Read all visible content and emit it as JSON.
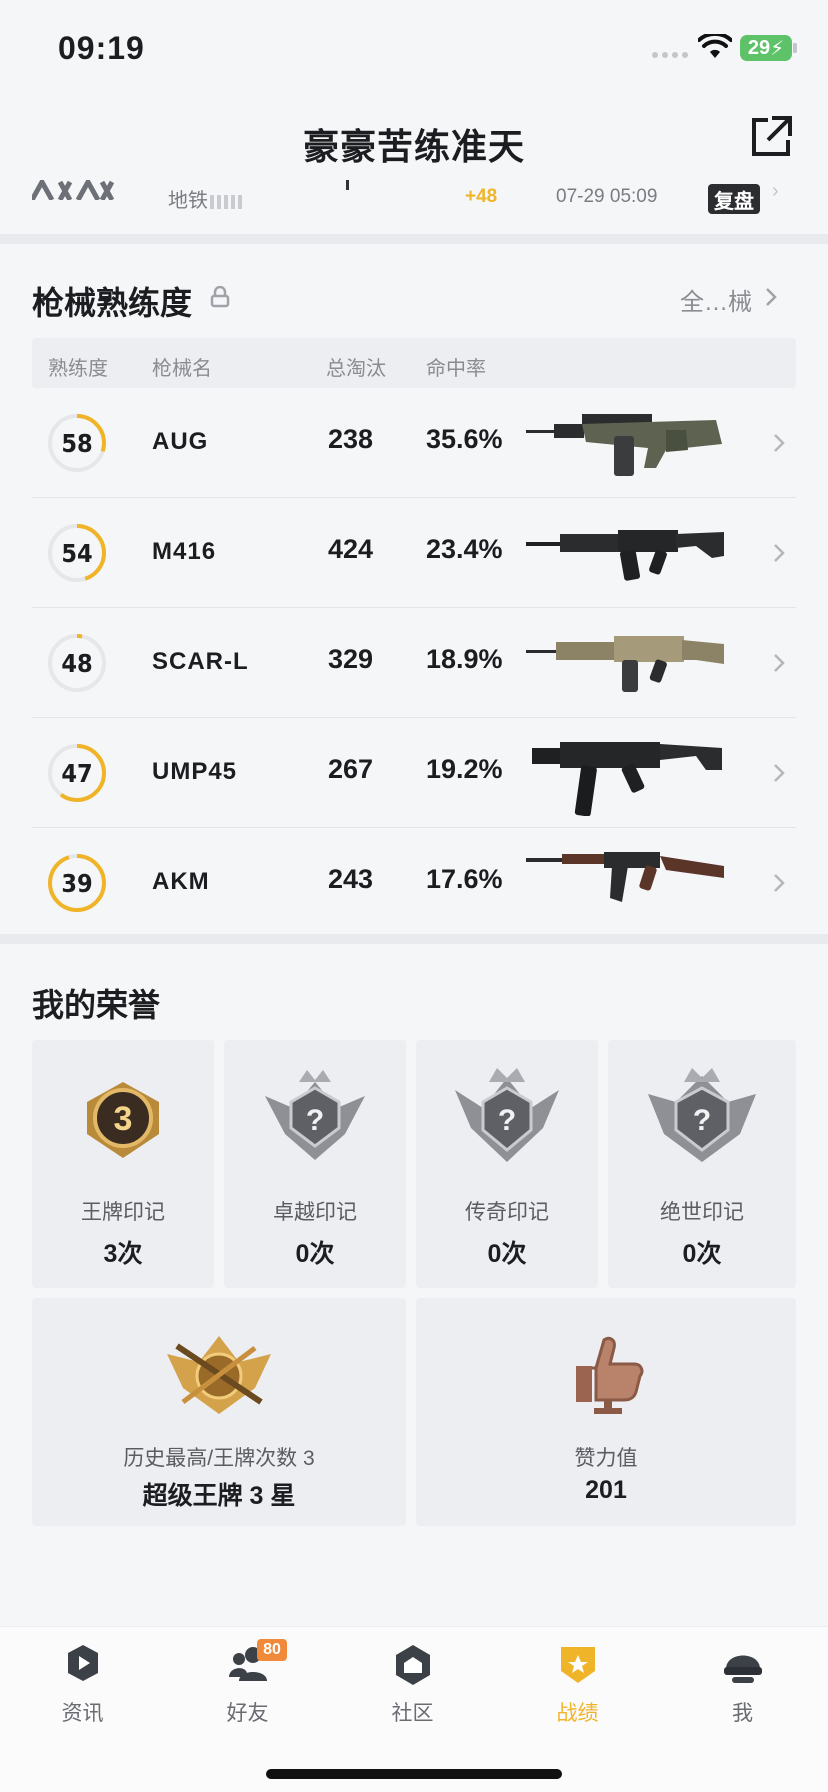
{
  "status": {
    "time": "09:19",
    "battery": "29"
  },
  "header": {
    "title": "豪豪苦练准天"
  },
  "match": {
    "map": "地铁",
    "score": "+48",
    "time": "07-29 05:09",
    "replay": "复盘"
  },
  "weapons": {
    "title": "枪械熟练度",
    "see_all": "全…械",
    "columns": {
      "level": "熟练度",
      "name": "枪械名",
      "kills": "总淘汰",
      "accuracy": "命中率"
    },
    "items": [
      {
        "level": "58",
        "progress": 0.3,
        "name": "AUG",
        "kills": "238",
        "accuracy": "35.6%"
      },
      {
        "level": "54",
        "progress": 0.45,
        "name": "M416",
        "kills": "424",
        "accuracy": "23.4%"
      },
      {
        "level": "48",
        "progress": 0.03,
        "name": "SCAR-L",
        "kills": "329",
        "accuracy": "18.9%"
      },
      {
        "level": "47",
        "progress": 0.6,
        "name": "UMP45",
        "kills": "267",
        "accuracy": "19.2%"
      },
      {
        "level": "39",
        "progress": 0.95,
        "name": "AKM",
        "kills": "243",
        "accuracy": "17.6%"
      }
    ]
  },
  "honors": {
    "title": "我的荣誉",
    "marks": [
      {
        "label": "王牌印记",
        "count": "3次",
        "badge_text": "3"
      },
      {
        "label": "卓越印记",
        "count": "0次",
        "badge_text": "?"
      },
      {
        "label": "传奇印记",
        "count": "0次",
        "badge_text": "?"
      },
      {
        "label": "绝世印记",
        "count": "0次",
        "badge_text": "?"
      }
    ],
    "best": {
      "label": "历史最高/王牌次数 3",
      "value": "超级王牌 3 星"
    },
    "likes": {
      "label": "赞力值",
      "value": "201"
    }
  },
  "tabs": [
    {
      "label": "资讯",
      "icon": "news-icon"
    },
    {
      "label": "好友",
      "icon": "friends-icon",
      "badge": "80"
    },
    {
      "label": "社区",
      "icon": "community-icon"
    },
    {
      "label": "战绩",
      "icon": "record-icon",
      "active": true
    },
    {
      "label": "我",
      "icon": "profile-icon"
    }
  ],
  "colors": {
    "accent": "#f0b429",
    "ring_track": "#e6e7ea"
  }
}
